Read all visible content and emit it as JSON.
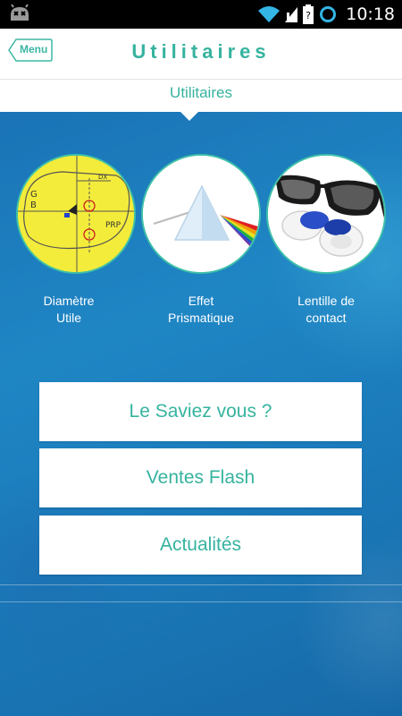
{
  "status_bar": {
    "time": "10:18",
    "icons": [
      "cyanogen-icon",
      "wifi-icon",
      "signal-icon",
      "battery-icon",
      "sync-icon"
    ]
  },
  "header": {
    "menu_label": "Menu",
    "title": "Utilitaires"
  },
  "subbar": {
    "title": "Utilitaires"
  },
  "tools": [
    {
      "line1": "Diamètre",
      "line2": "Utile"
    },
    {
      "line1": "Effet",
      "line2": "Prismatique"
    },
    {
      "line1": "Lentille de",
      "line2": "contact"
    }
  ],
  "buttons": [
    {
      "label": "Le Saviez vous ?"
    },
    {
      "label": "Ventes Flash"
    },
    {
      "label": "Actualités"
    }
  ],
  "colors": {
    "accent": "#36b39f",
    "background": "#1d6fb0",
    "status_bar": "#000000"
  }
}
